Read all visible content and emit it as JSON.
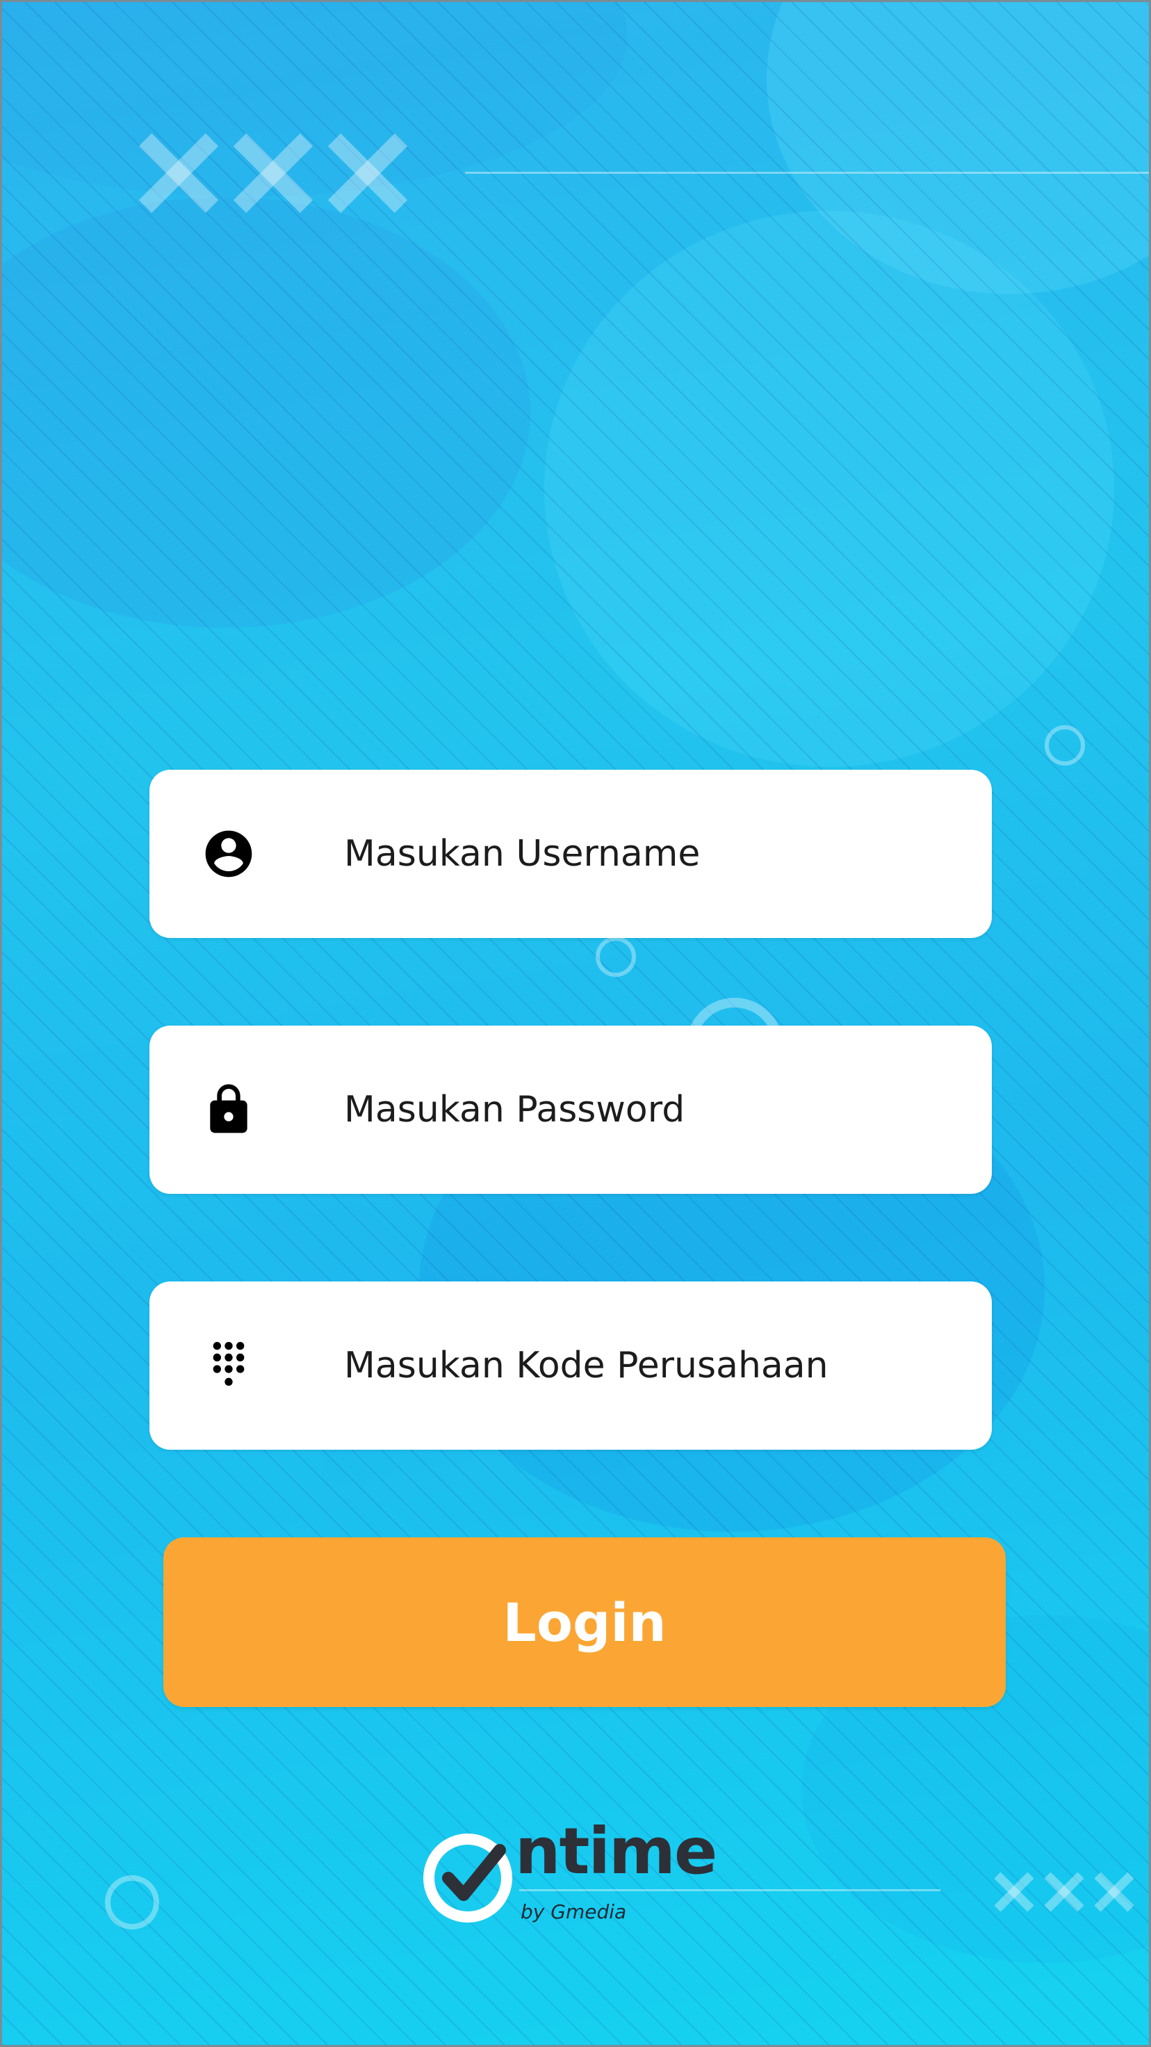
{
  "login_form": {
    "username": {
      "placeholder": "Masukan Username",
      "value": "",
      "icon": "account-circle-icon"
    },
    "password": {
      "placeholder": "Masukan Password",
      "value": "",
      "icon": "lock-icon"
    },
    "company_code": {
      "placeholder": "Masukan Kode Perusahaan",
      "value": "",
      "icon": "dialpad-icon"
    },
    "login_label": "Login"
  },
  "brand": {
    "name": "ntime",
    "byline": "by Gmedia"
  },
  "colors": {
    "background": "#22c4ee",
    "field_background": "#ffffff",
    "button": "#fba634",
    "button_text": "#ffffff",
    "logo_text": "#2e3038"
  }
}
